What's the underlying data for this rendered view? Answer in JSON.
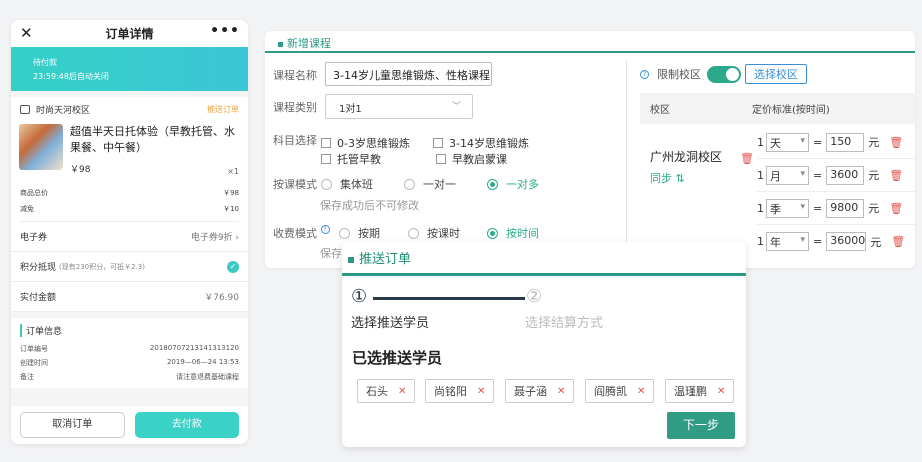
{
  "phone": {
    "title": "订单详情",
    "status_main": "待付款",
    "status_sub": "23:59:48后自动关闭",
    "shop_name": "时尚天河校区",
    "order_tag": "推送订单",
    "product_title": "超值半天日托体验（早教托管、水果餐、中午餐）",
    "price": "￥98",
    "qty": "×1",
    "goods_total_label": "商品总价",
    "goods_total": "￥98",
    "discount_label": "减免",
    "discount": "￥10",
    "coupon_label": "电子券",
    "coupon_value": "电子券9折 ›",
    "points_label": "积分抵现",
    "points_note": "(现有230积分，可抵￥2.3)",
    "paid_label": "实付金额",
    "paid_value": "￥76.90",
    "info_title": "订单信息",
    "info_rows": [
      {
        "label": "订单编号",
        "value": "20180707213141313120"
      },
      {
        "label": "创建时间",
        "value": "2019—06—24 13:53"
      },
      {
        "label": "备注",
        "value": "请注意退费基础课程"
      }
    ],
    "cancel_label": "取消订单",
    "pay_label": "去付款"
  },
  "course": {
    "title": "新增课程",
    "name_label": "课程名称",
    "name_value": "3-14岁儿童思维锻炼、性格课程",
    "type_label": "课程类别",
    "type_value": "1对1",
    "subject_label": "科目选择",
    "subjects": [
      "0-3岁思维锻炼",
      "3-14岁思维锻炼",
      "托管早教",
      "早教启蒙课"
    ],
    "mode_label": "按课模式",
    "modes": [
      "集体班",
      "一对一",
      "一对多"
    ],
    "mode_hint": "保存成功后不可修改",
    "fee_label": "收费模式",
    "fees": [
      "按期",
      "按课时",
      "按时间"
    ],
    "fee_hint": "保存",
    "limit_label": "限制校区",
    "choose_campus": "选择校区",
    "col_campus": "校区",
    "col_price": "定价标准(按时间)",
    "campus_name": "广州龙洞校区",
    "sync_label": "同步",
    "yuan": "元",
    "prices": [
      {
        "n": "1",
        "unit": "天",
        "value": "150"
      },
      {
        "n": "1",
        "unit": "月",
        "value": "3600"
      },
      {
        "n": "1",
        "unit": "季",
        "value": "9800"
      },
      {
        "n": "1",
        "unit": "年",
        "value": "36000"
      }
    ]
  },
  "push": {
    "title": "推送订单",
    "step1_num": "①",
    "step1_label": "选择推送学员",
    "step2_num": "②",
    "step2_label": "选择结算方式",
    "chosen_title": "已选推送学员",
    "students": [
      "石头",
      "尚铭阳",
      "聂子涵",
      "阎腾凯",
      "温瑾鹏"
    ],
    "next_label": "下一步"
  }
}
